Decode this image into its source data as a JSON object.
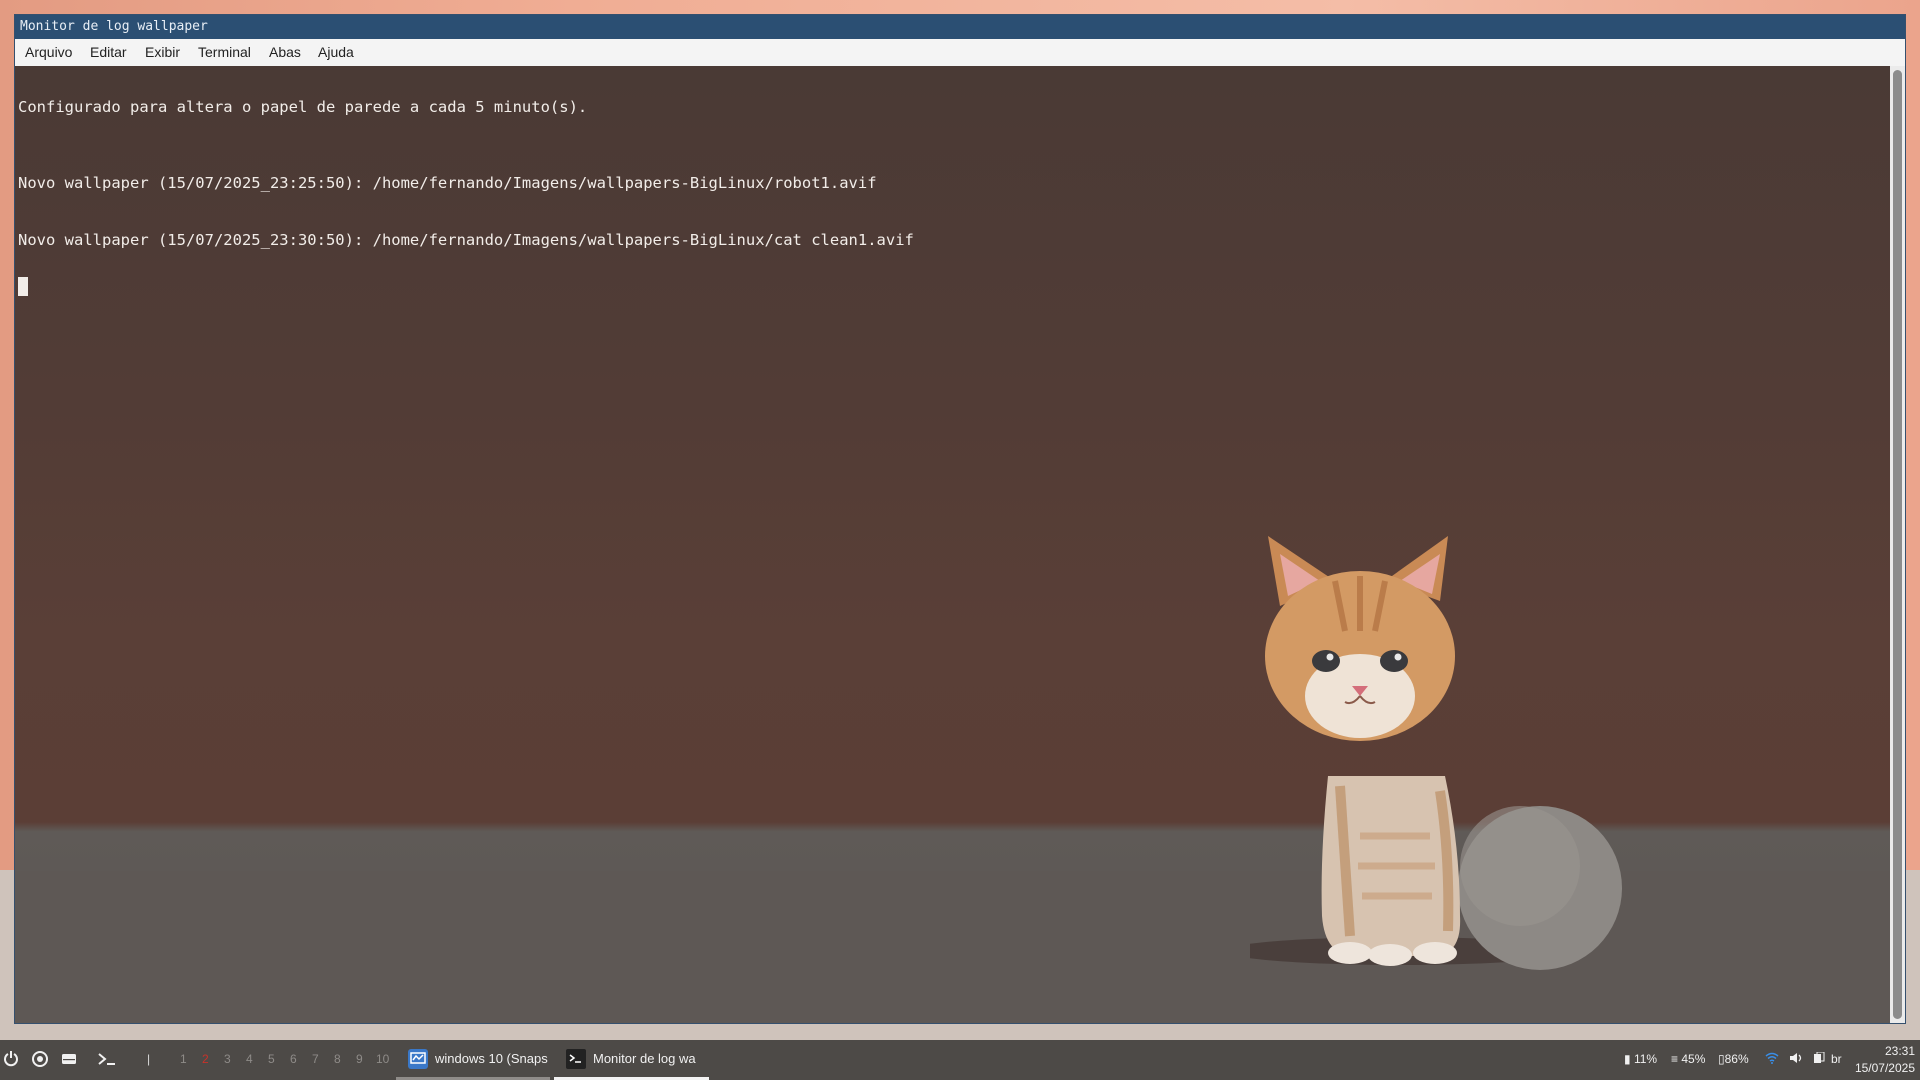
{
  "window": {
    "title": "Monitor de log wallpaper"
  },
  "menu": [
    "Arquivo",
    "Editar",
    "Exibir",
    "Terminal",
    "Abas",
    "Ajuda"
  ],
  "terminal": {
    "lines": [
      "Configurado para altera o papel de parede a cada 5 minuto(s).",
      "Novo wallpaper (15/07/2025_23:25:50): /home/fernando/Imagens/wallpapers-BigLinux/robot1.avif",
      "Novo wallpaper (15/07/2025_23:30:50): /home/fernando/Imagens/wallpapers-BigLinux/cat clean1.avif"
    ]
  },
  "taskbar": {
    "launchers": [
      "power-icon",
      "refresh-icon",
      "drive-icon",
      "terminal-icon"
    ],
    "separator": "|",
    "workspaces": [
      "1",
      "2",
      "3",
      "4",
      "5",
      "6",
      "7",
      "8",
      "9",
      "10"
    ],
    "active_workspace": "2",
    "tasks": [
      {
        "label": "windows 10 (Snaps",
        "icon": "monitor-app-icon"
      },
      {
        "label": "Monitor de log wa",
        "icon": "terminal-app-icon"
      }
    ],
    "tray": {
      "disk": "11%",
      "mem": "45%",
      "battery": "86%",
      "lang": "br"
    },
    "clock": {
      "time": "23:31",
      "date": "15/07/2025"
    }
  },
  "colors": {
    "titlebar": "#2b4f73",
    "terminal_text": "#f2ede9",
    "workspace_active": "#c7322a"
  }
}
